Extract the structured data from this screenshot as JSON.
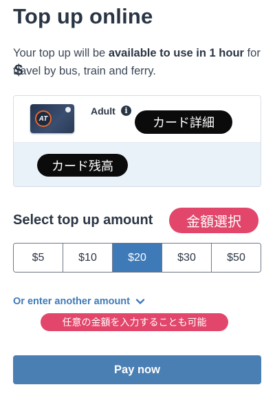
{
  "page": {
    "title": "Top up online"
  },
  "intro": {
    "text_1": "Your top up will be ",
    "bold_1": "available to use in 1 hour",
    "text_2": " for travel by bus, train and ferry."
  },
  "card": {
    "logo_text": "AT",
    "type_label": "Adult",
    "info_icon": "info-icon",
    "balance_prefix": "$"
  },
  "annotations": {
    "card_detail": "カード詳細",
    "card_balance": "カード残高",
    "amount_select": "金額選択",
    "any_amount": "任意の金額を入力することも可能"
  },
  "amount_section": {
    "title": "Select top up amount",
    "options": [
      "$5",
      "$10",
      "$20",
      "$30",
      "$50"
    ],
    "selected_index": 2
  },
  "other_amount": {
    "label": "Or enter another amount",
    "icon": "chevron-down-icon"
  },
  "pay": {
    "label": "Pay now"
  },
  "colors": {
    "text": "#2a3544",
    "accent": "#3f7ab8",
    "pay_button": "#4a7fb3",
    "annotation_pink": "#e2466a",
    "annotation_black": "#0b0b0b"
  }
}
